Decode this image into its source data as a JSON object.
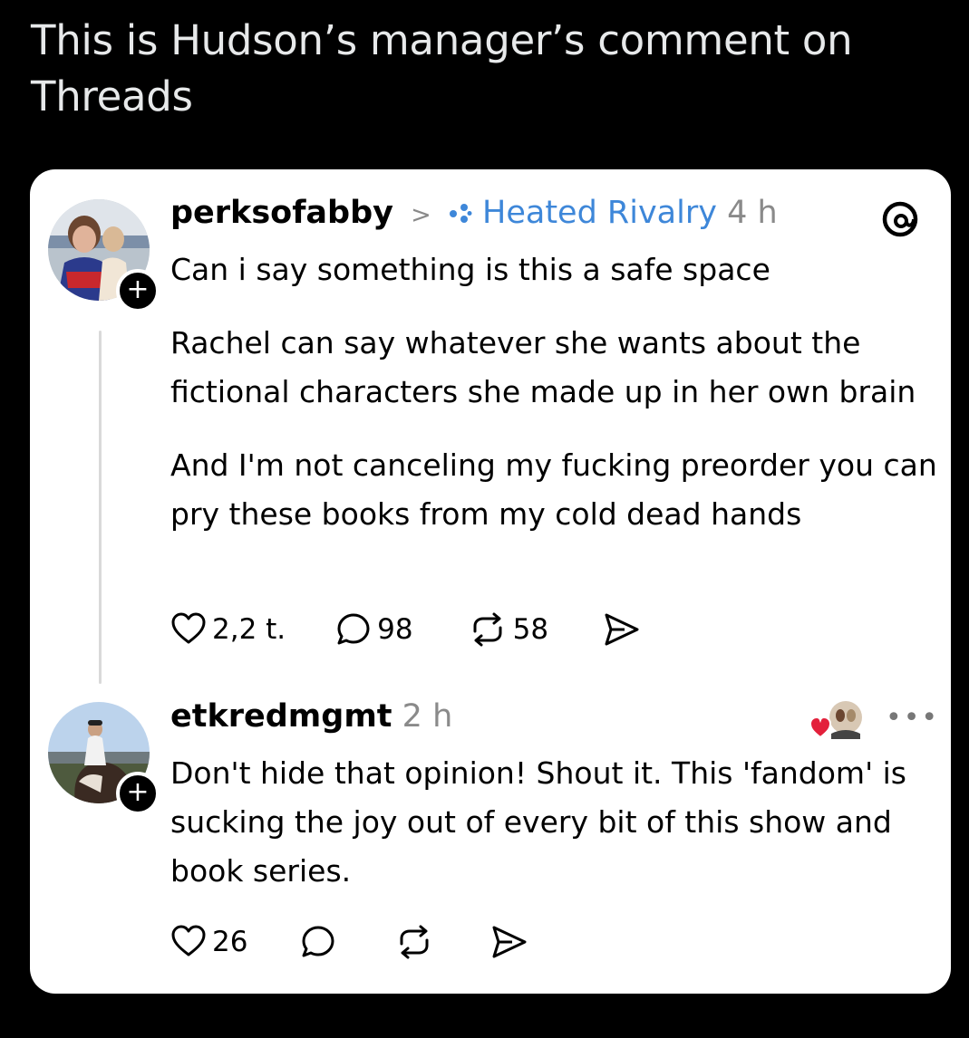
{
  "caption": "This is Hudson’s manager’s comment on Threads",
  "post": {
    "username": "perksofabby",
    "separator": ">",
    "topic": "Heated Rivalry",
    "time": "4 h",
    "paragraphs": [
      "Can i say something is this a safe space",
      "Rachel can say whatever she wants about the fictional characters she made up in her own brain",
      "And I'm not canceling my fucking preorder you can pry these books from my cold dead hands"
    ],
    "likes": "2,2 t.",
    "replies": "98",
    "reposts": "58"
  },
  "reply": {
    "username": "etkredmgmt",
    "time": "2 h",
    "text": "Don't hide that opinion! Shout it. This 'fandom' is sucking the joy out of every bit of this show and book series.",
    "likes": "26"
  },
  "icons": {
    "heart": "heart-icon",
    "comment": "comment-icon",
    "repost": "repost-icon",
    "share": "share-icon",
    "threads": "threads-logo-icon",
    "more": "more-icon"
  }
}
